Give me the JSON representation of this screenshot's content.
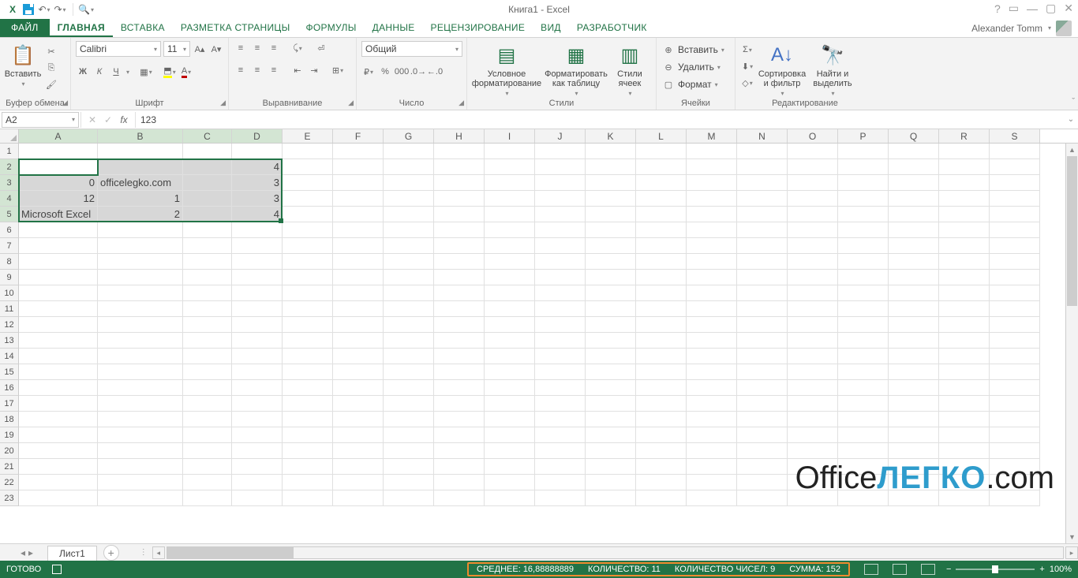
{
  "title": "Книга1 - Excel",
  "user": "Alexander Tomm",
  "tabs": {
    "file": "ФАЙЛ",
    "home": "ГЛАВНАЯ",
    "insert": "ВСТАВКА",
    "layout": "РАЗМЕТКА СТРАНИЦЫ",
    "formulas": "ФОРМУЛЫ",
    "data": "ДАННЫЕ",
    "review": "РЕЦЕНЗИРОВАНИЕ",
    "view": "ВИД",
    "dev": "РАЗРАБОТЧИК"
  },
  "ribbon": {
    "clipboard": {
      "label": "Буфер обмена",
      "paste": "Вставить"
    },
    "font": {
      "label": "Шрифт",
      "name": "Calibri",
      "size": "11",
      "bold": "Ж",
      "italic": "К",
      "underline": "Ч"
    },
    "align": {
      "label": "Выравнивание"
    },
    "number": {
      "label": "Число",
      "format": "Общий"
    },
    "styles": {
      "label": "Стили",
      "cond": "Условное форматирование",
      "table": "Форматировать как таблицу",
      "cellstyles": "Стили ячеек"
    },
    "cells": {
      "label": "Ячейки",
      "insert": "Вставить",
      "delete": "Удалить",
      "format": "Формат"
    },
    "editing": {
      "label": "Редактирование",
      "sort": "Сортировка и фильтр",
      "find": "Найти и выделить"
    }
  },
  "fbar": {
    "name": "A2",
    "formula": "123"
  },
  "columns": [
    "A",
    "B",
    "C",
    "D",
    "E",
    "F",
    "G",
    "H",
    "I",
    "J",
    "K",
    "L",
    "M",
    "N",
    "O",
    "P",
    "Q",
    "R",
    "S"
  ],
  "col_widths": {
    "A": 100,
    "B": 108,
    "C": 62,
    "D": 64,
    "other": 64
  },
  "selected_cols": [
    "A",
    "B",
    "C",
    "D"
  ],
  "selected_rows": [
    2,
    3,
    4,
    5
  ],
  "active_cell": "A2",
  "rows_visible": 23,
  "cells": {
    "A2": "123",
    "D2": "4",
    "A3": "0",
    "B3": "officelegko.com",
    "D3": "3",
    "A4": "12",
    "B4": "1",
    "D4": "3",
    "A5": "Microsoft Excel",
    "B5": "2",
    "D5": "4"
  },
  "left_align": [
    "B3",
    "A5"
  ],
  "sheet": {
    "name": "Лист1"
  },
  "status": {
    "ready": "ГОТОВО",
    "avg": "СРЕДНЕЕ: 16,88888889",
    "count": "КОЛИЧЕСТВО: 11",
    "countnum": "КОЛИЧЕСТВО ЧИСЕЛ: 9",
    "sum": "СУММА: 152",
    "zoom": "100%"
  },
  "watermark": {
    "a": "Office",
    "b": "ЛЕГКО",
    "c": ".com"
  }
}
